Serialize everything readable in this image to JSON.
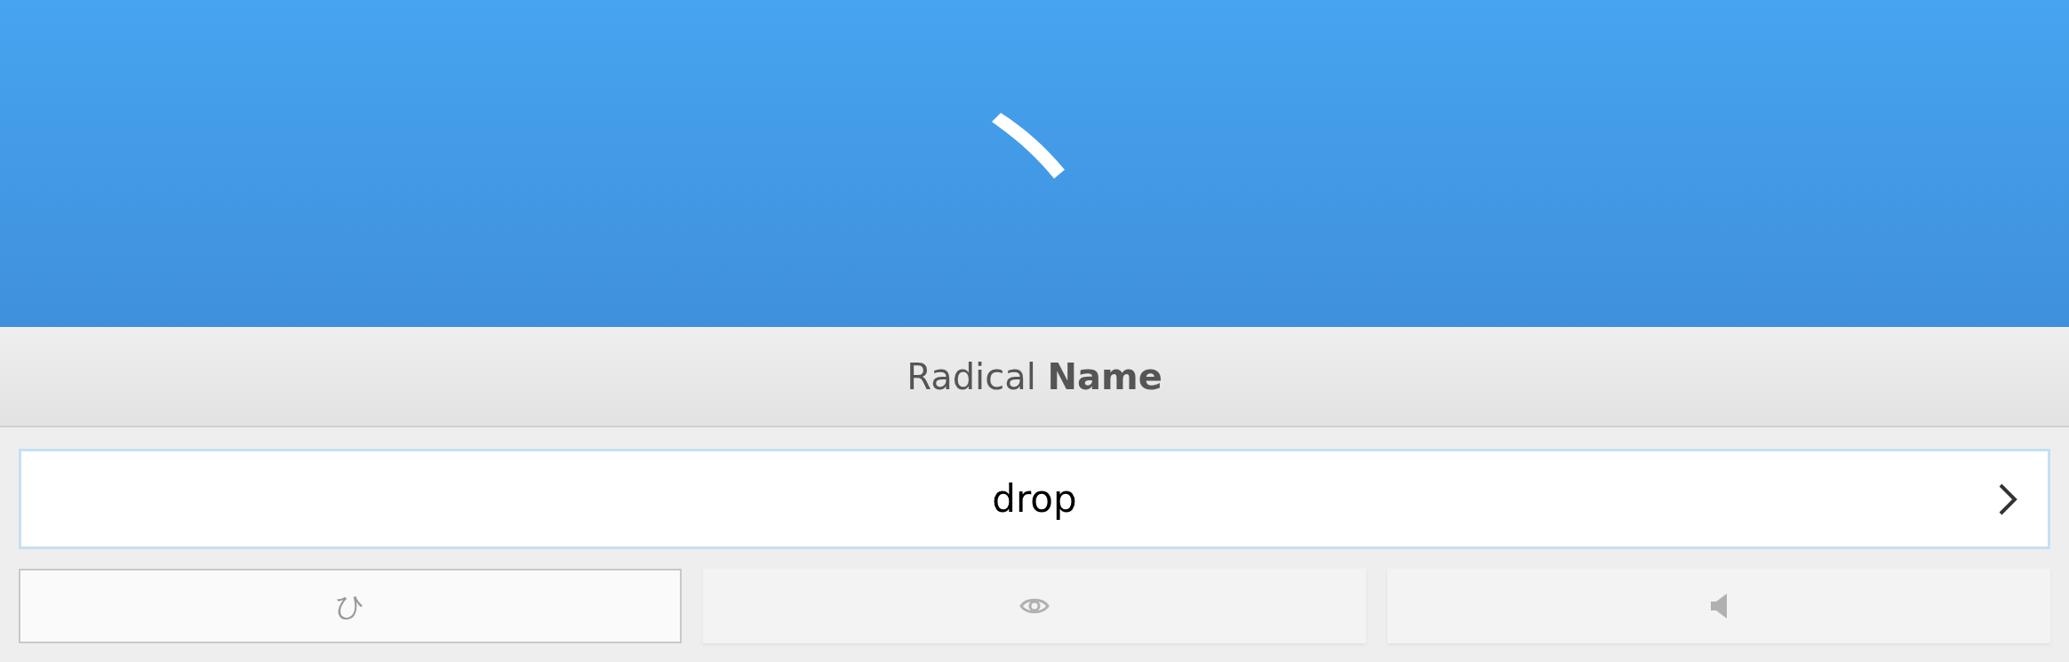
{
  "header": {
    "title": "Radical **Name**"
  },
  "answer": {
    "value": "drop"
  },
  "buttons": [
    {
      "kind": "kana",
      "label": "ひ",
      "selected": true
    },
    {
      "kind": "eye",
      "selected": false
    },
    {
      "kind": "audio",
      "selected": false
    }
  ]
}
